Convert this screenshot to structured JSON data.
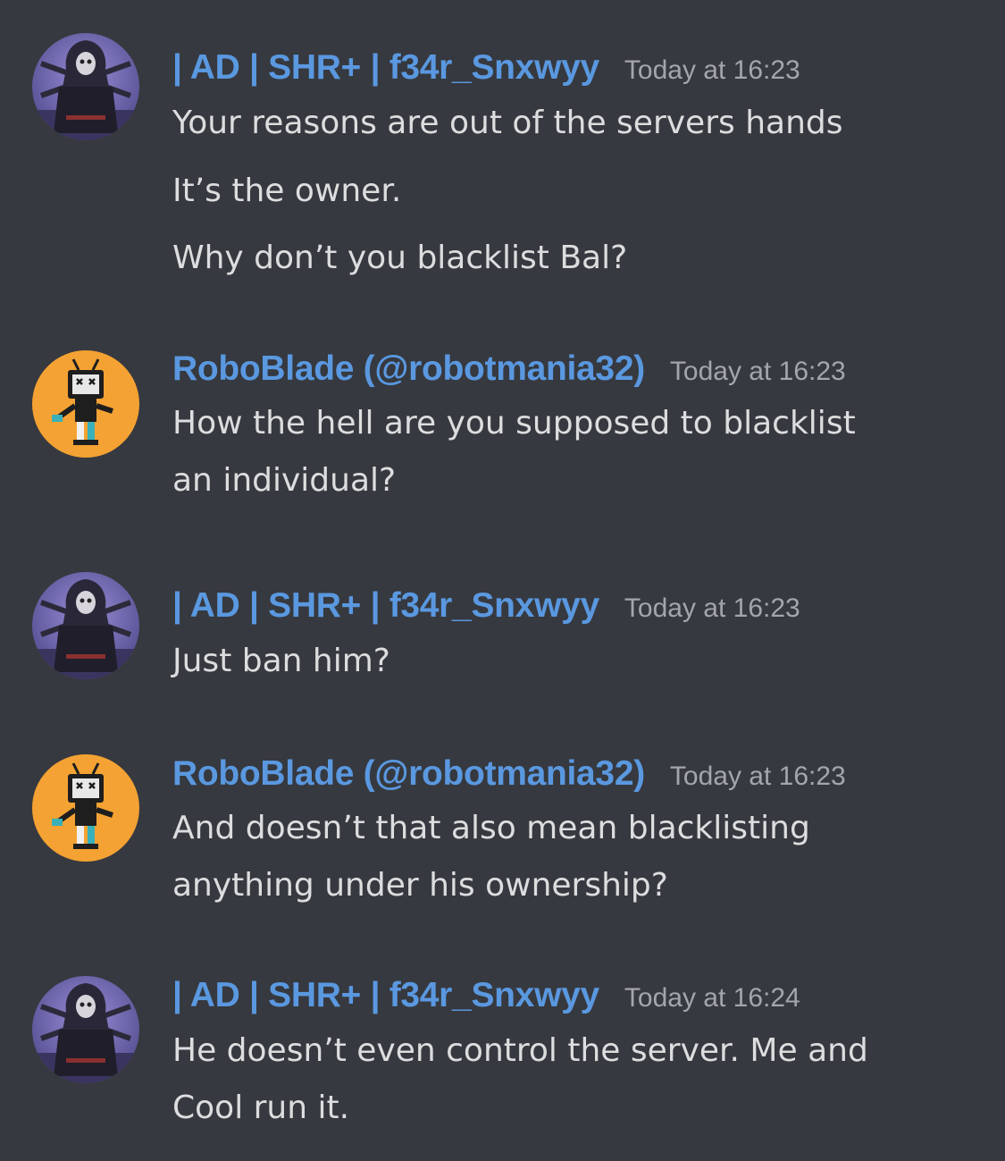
{
  "messages": [
    {
      "author": "| AD | SHR+ | f34r_Snxwyy",
      "timestamp": "Today at 16:23",
      "avatar_icon": "hooded-reaper-avatar",
      "lines": [
        "Your reasons are out of the servers hands",
        "It’s the owner.",
        "Why don’t you blacklist Bal?"
      ]
    },
    {
      "author": "RoboBlade (@robotmania32)",
      "timestamp": "Today at 16:23",
      "avatar_icon": "tv-head-robot-avatar",
      "lines": [
        "How the hell are you supposed to blacklist",
        "an individual?"
      ]
    },
    {
      "author": "| AD | SHR+ | f34r_Snxwyy",
      "timestamp": "Today at 16:23",
      "avatar_icon": "hooded-reaper-avatar",
      "lines": [
        "Just ban him?"
      ]
    },
    {
      "author": "RoboBlade (@robotmania32)",
      "timestamp": "Today at 16:23",
      "avatar_icon": "tv-head-robot-avatar",
      "lines": [
        "And doesn’t that also mean blacklisting",
        "anything under his ownership?"
      ]
    },
    {
      "author": "| AD | SHR+ | f34r_Snxwyy",
      "timestamp": "Today at 16:24",
      "avatar_icon": "hooded-reaper-avatar",
      "lines": [
        "He doesn’t even control the server. Me and",
        "Cool run it."
      ]
    }
  ],
  "colors": {
    "background": "#36393f",
    "username": "#5a98e0",
    "timestamp": "#a3a6aa",
    "message_text": "#dcddde",
    "robot_avatar_bg": "#f4a233",
    "reaper_avatar_bg": "#7a6fb8"
  }
}
